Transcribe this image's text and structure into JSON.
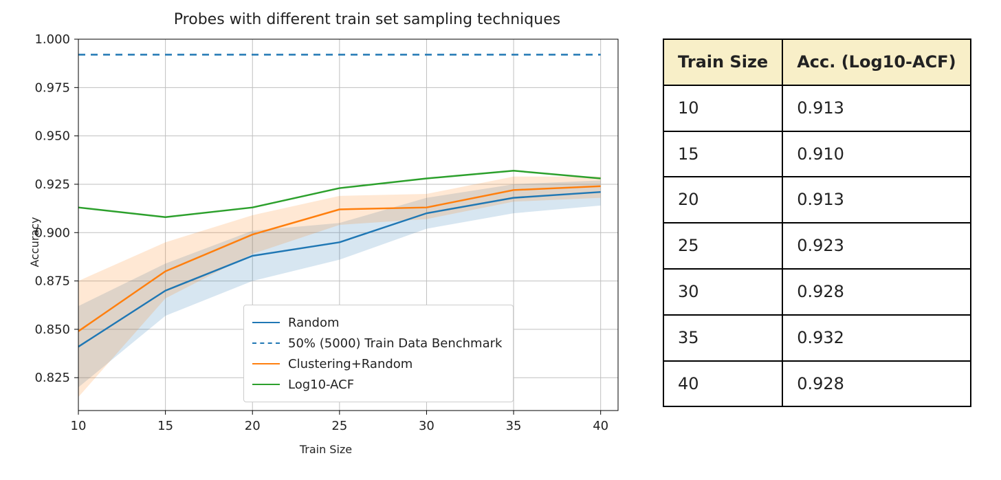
{
  "chart_data": {
    "type": "line",
    "title": "Probes with different train set sampling techniques",
    "xlabel": "Train Size",
    "ylabel": "Accuracy",
    "x": [
      10,
      15,
      20,
      25,
      30,
      35,
      40
    ],
    "xlim": [
      10,
      41
    ],
    "ylim": [
      0.808,
      1.0
    ],
    "yticks": [
      0.825,
      0.85,
      0.875,
      0.9,
      0.925,
      0.95,
      0.975,
      1.0
    ],
    "grid": true,
    "legend_position": "lower center",
    "series": [
      {
        "name": "Random",
        "color": "#1f77b4",
        "style": "solid",
        "values": [
          0.841,
          0.87,
          0.888,
          0.895,
          0.91,
          0.918,
          0.921
        ],
        "band_lower": [
          0.82,
          0.857,
          0.875,
          0.886,
          0.902,
          0.91,
          0.914
        ],
        "band_upper": [
          0.862,
          0.884,
          0.901,
          0.905,
          0.918,
          0.925,
          0.927
        ]
      },
      {
        "name": "50% (5000) Train Data Benchmark",
        "color": "#1f77b4",
        "style": "dashed",
        "values": [
          0.992,
          0.992,
          0.992,
          0.992,
          0.992,
          0.992,
          0.992
        ]
      },
      {
        "name": "Clustering+Random",
        "color": "#ff7f0e",
        "style": "solid",
        "values": [
          0.849,
          0.88,
          0.899,
          0.912,
          0.913,
          0.922,
          0.924
        ],
        "band_lower": [
          0.815,
          0.866,
          0.889,
          0.904,
          0.907,
          0.916,
          0.918
        ],
        "band_upper": [
          0.875,
          0.895,
          0.909,
          0.919,
          0.92,
          0.929,
          0.929
        ]
      },
      {
        "name": "Log10-ACF",
        "color": "#2ca02c",
        "style": "solid",
        "values": [
          0.913,
          0.908,
          0.913,
          0.923,
          0.928,
          0.932,
          0.928
        ]
      }
    ]
  },
  "table": {
    "headers": [
      "Train Size",
      "Acc. (Log10-ACF)"
    ],
    "rows": [
      [
        "10",
        "0.913"
      ],
      [
        "15",
        "0.910"
      ],
      [
        "20",
        "0.913"
      ],
      [
        "25",
        "0.923"
      ],
      [
        "30",
        "0.928"
      ],
      [
        "35",
        "0.932"
      ],
      [
        "40",
        "0.928"
      ]
    ]
  }
}
